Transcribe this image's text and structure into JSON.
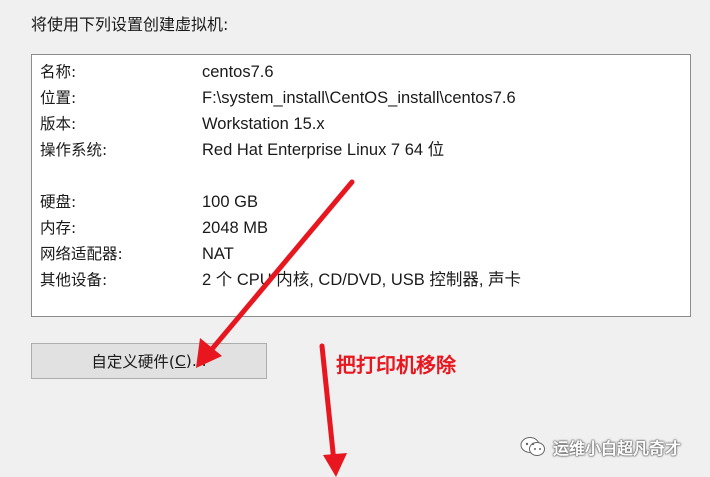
{
  "dialog": {
    "intro_text": "将使用下列设置创建虚拟机:"
  },
  "summary": {
    "rows": [
      {
        "label": "名称:",
        "value": "centos7.6"
      },
      {
        "label": "位置:",
        "value": "F:\\system_install\\CentOS_install\\centos7.6"
      },
      {
        "label": "版本:",
        "value": "Workstation 15.x"
      },
      {
        "label": "操作系统:",
        "value": "Red Hat Enterprise Linux 7 64 位"
      },
      {
        "label": "硬盘:",
        "value": "100 GB"
      },
      {
        "label": "内存:",
        "value": "2048 MB"
      },
      {
        "label": "网络适配器:",
        "value": "NAT"
      },
      {
        "label": "其他设备:",
        "value": "2 个 CPU 内核, CD/DVD, USB 控制器, 声卡"
      }
    ]
  },
  "customize_button": {
    "label_prefix": "自定义硬件(",
    "mnemonic": "C",
    "label_suffix": ")..."
  },
  "annotation": {
    "text": "把打印机移除",
    "color": "#e8161e"
  },
  "watermark": {
    "icon": "wechat-icon",
    "text": "运维小白超凡奇才"
  }
}
